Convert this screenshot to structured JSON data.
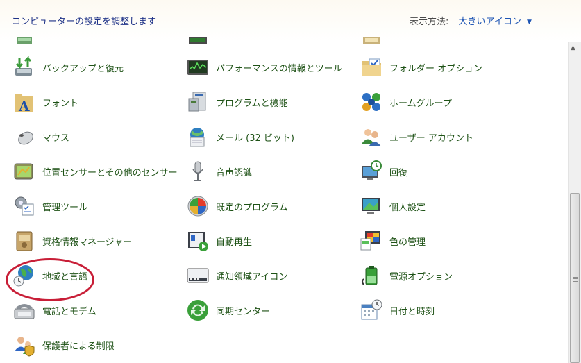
{
  "header": {
    "title": "コンピューターの設定を調整します",
    "view_by_label": "表示方法:",
    "view_by_value": "大きいアイコン"
  },
  "items": [
    {
      "label": "バックアップと復元",
      "icon": "backup-restore-icon"
    },
    {
      "label": "パフォーマンスの情報とツール",
      "icon": "performance-icon"
    },
    {
      "label": "フォルダー オプション",
      "icon": "folder-options-icon"
    },
    {
      "label": "フォント",
      "icon": "fonts-icon"
    },
    {
      "label": "プログラムと機能",
      "icon": "programs-features-icon"
    },
    {
      "label": "ホームグループ",
      "icon": "homegroup-icon"
    },
    {
      "label": "マウス",
      "icon": "mouse-icon"
    },
    {
      "label": "メール (32 ビット)",
      "icon": "mail-icon"
    },
    {
      "label": "ユーザー アカウント",
      "icon": "user-accounts-icon"
    },
    {
      "label": "位置センサーとその他のセンサー",
      "icon": "location-sensors-icon"
    },
    {
      "label": "音声認識",
      "icon": "microphone-icon"
    },
    {
      "label": "回復",
      "icon": "recovery-icon"
    },
    {
      "label": "管理ツール",
      "icon": "admin-tools-icon"
    },
    {
      "label": "既定のプログラム",
      "icon": "default-programs-icon"
    },
    {
      "label": "個人設定",
      "icon": "personalization-icon"
    },
    {
      "label": "資格情報マネージャー",
      "icon": "credential-manager-icon"
    },
    {
      "label": "自動再生",
      "icon": "autoplay-icon"
    },
    {
      "label": "色の管理",
      "icon": "color-management-icon"
    },
    {
      "label": "地域と言語",
      "icon": "region-language-icon"
    },
    {
      "label": "通知領域アイコン",
      "icon": "notification-area-icon"
    },
    {
      "label": "電源オプション",
      "icon": "power-options-icon"
    },
    {
      "label": "電話とモデム",
      "icon": "phone-modem-icon"
    },
    {
      "label": "同期センター",
      "icon": "sync-center-icon"
    },
    {
      "label": "日付と時刻",
      "icon": "date-time-icon"
    },
    {
      "label": "保護者による制限",
      "icon": "parental-controls-icon"
    }
  ],
  "highlight": {
    "target": "地域と言語",
    "color": "#c81e37"
  },
  "colors": {
    "label_text": "#1e5216",
    "header_title": "#1e3287",
    "link": "#1e55b4"
  }
}
